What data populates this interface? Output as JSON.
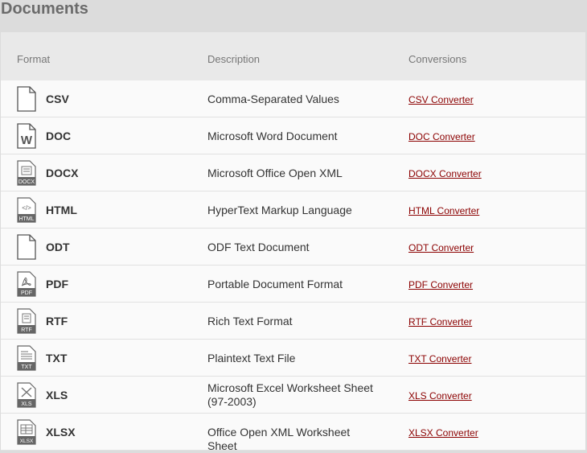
{
  "page_title": "Documents",
  "table": {
    "headers": {
      "format": "Format",
      "description": "Description",
      "conversions": "Conversions"
    },
    "rows": [
      {
        "format": "CSV",
        "description": "Comma-Separated Values",
        "conversion": "CSV Converter",
        "icon": "file-blank-icon"
      },
      {
        "format": "DOC",
        "description": "Microsoft Word Document",
        "conversion": "DOC Converter",
        "icon": "word-doc-icon"
      },
      {
        "format": "DOCX",
        "description": "Microsoft Office Open XML",
        "conversion": "DOCX Converter",
        "icon": "docx-file-icon"
      },
      {
        "format": "HTML",
        "description": "HyperText Markup Language",
        "conversion": "HTML Converter",
        "icon": "html-file-icon"
      },
      {
        "format": "ODT",
        "description": "ODF Text Document",
        "conversion": "ODT Converter",
        "icon": "file-blank-icon"
      },
      {
        "format": "PDF",
        "description": "Portable Document Format",
        "conversion": "PDF Converter",
        "icon": "pdf-file-icon"
      },
      {
        "format": "RTF",
        "description": "Rich Text Format",
        "conversion": "RTF Converter",
        "icon": "rtf-file-icon"
      },
      {
        "format": "TXT",
        "description": "Plaintext Text File",
        "conversion": "TXT Converter",
        "icon": "txt-file-icon"
      },
      {
        "format": "XLS",
        "description": "Microsoft Excel Worksheet Sheet (97-2003)",
        "conversion": "XLS Converter",
        "icon": "xls-file-icon"
      },
      {
        "format": "XLSX",
        "description": "Office Open XML Worksheet Sheet",
        "conversion": "XLSX Converter",
        "icon": "xlsx-file-icon"
      }
    ],
    "icon_labels": {
      "docx": "DOCX",
      "html": "HTML",
      "pdf": "PDF",
      "rtf": "RTF",
      "txt": "TXT",
      "xls": "XLS",
      "xlsx": "XLSX",
      "word": "W",
      "html_tag": "</>"
    }
  },
  "colors": {
    "link": "#8b0000",
    "header_bg": "#e9e9e9",
    "page_bg": "#dcdcdc"
  }
}
